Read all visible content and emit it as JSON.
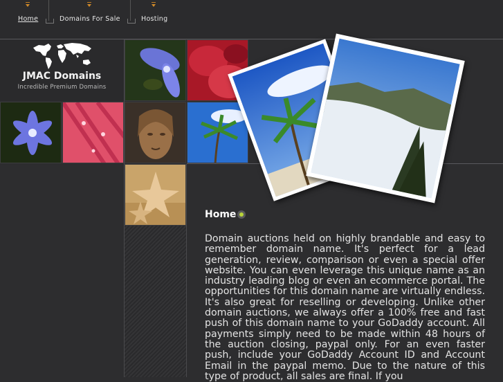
{
  "nav": {
    "items": [
      {
        "label": "Home",
        "active": true
      },
      {
        "label": "Domains For Sale",
        "active": false
      },
      {
        "label": "Hosting",
        "active": false
      }
    ]
  },
  "logo": {
    "icon": "world-map-icon",
    "title": "JMAC Domains",
    "subtitle": "Incredible Premium Domains"
  },
  "gallery": {
    "tiles": [
      "blue-flower-closeup",
      "red-petals",
      "blue-flower",
      "pink-droplets-petals",
      "bronze-statue-face",
      "palm-trees-sky",
      "starfish-on-sand"
    ],
    "featured_photos": [
      "palm-trees-beach",
      "coastal-fog-mountain"
    ]
  },
  "content": {
    "title": "Home",
    "body": "Domain auctions held on highly brandable and easy to remember domain name. It's perfect for a lead generation, review, comparison or even a special offer website. You can even leverage this unique name as an industry leading blog or even an ecommerce portal. The opportunities for this domain name are virtually endless. It's also great for reselling or developing. Unlike other domain auctions, we always offer a 100% free and fast push of this domain name to your GoDaddy account. All payments simply need to be made within 48 hours of the auction closing, paypal only. For an even faster push, include your GoDaddy Account ID and Account Email in the paypal memo. Due to the nature of this type of product, all sales are final. If you"
  },
  "colors": {
    "accent": "#d08a2a",
    "bullet": "#b9d43a",
    "background": "#2d2d2f"
  }
}
